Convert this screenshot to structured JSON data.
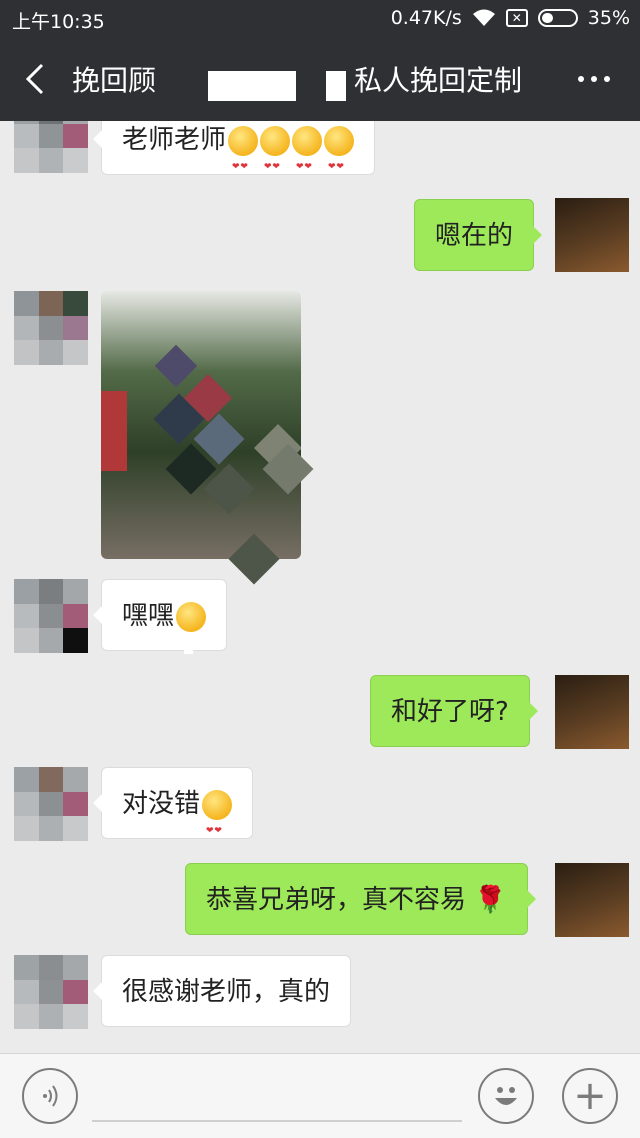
{
  "status_bar": {
    "time": "上午10:35",
    "network_speed": "0.47K/s",
    "battery_percent": "35%",
    "battery_level": 0.35
  },
  "header": {
    "title_left": "挽回顾",
    "title_right": "私人挽回定制",
    "more_icon": "more-icon",
    "back_icon": "back-arrow-icon"
  },
  "messages": [
    {
      "side": "left",
      "text": "老师老师",
      "emoji": "heart-eyes x4"
    },
    {
      "side": "right",
      "text": "嗯在的"
    },
    {
      "side": "left",
      "type": "image"
    },
    {
      "side": "left",
      "text": "嘿嘿",
      "emoji": "grin"
    },
    {
      "side": "right",
      "text": "和好了呀?"
    },
    {
      "side": "left",
      "text": "对没错",
      "emoji": "heart-eyes"
    },
    {
      "side": "right",
      "text": "恭喜兄弟呀，真不容易",
      "emoji": "rose"
    },
    {
      "side": "left",
      "text": "很感谢老师，真的"
    }
  ],
  "input_bar": {
    "voice_icon": "voice-icon",
    "emoji_icon": "emoji-face-icon",
    "add_icon": "plus-icon"
  },
  "colors": {
    "bar_bg": "#2f3033",
    "chat_bg": "#ebebeb",
    "own_bubble": "#9ee95a",
    "other_bubble": "#ffffff"
  }
}
